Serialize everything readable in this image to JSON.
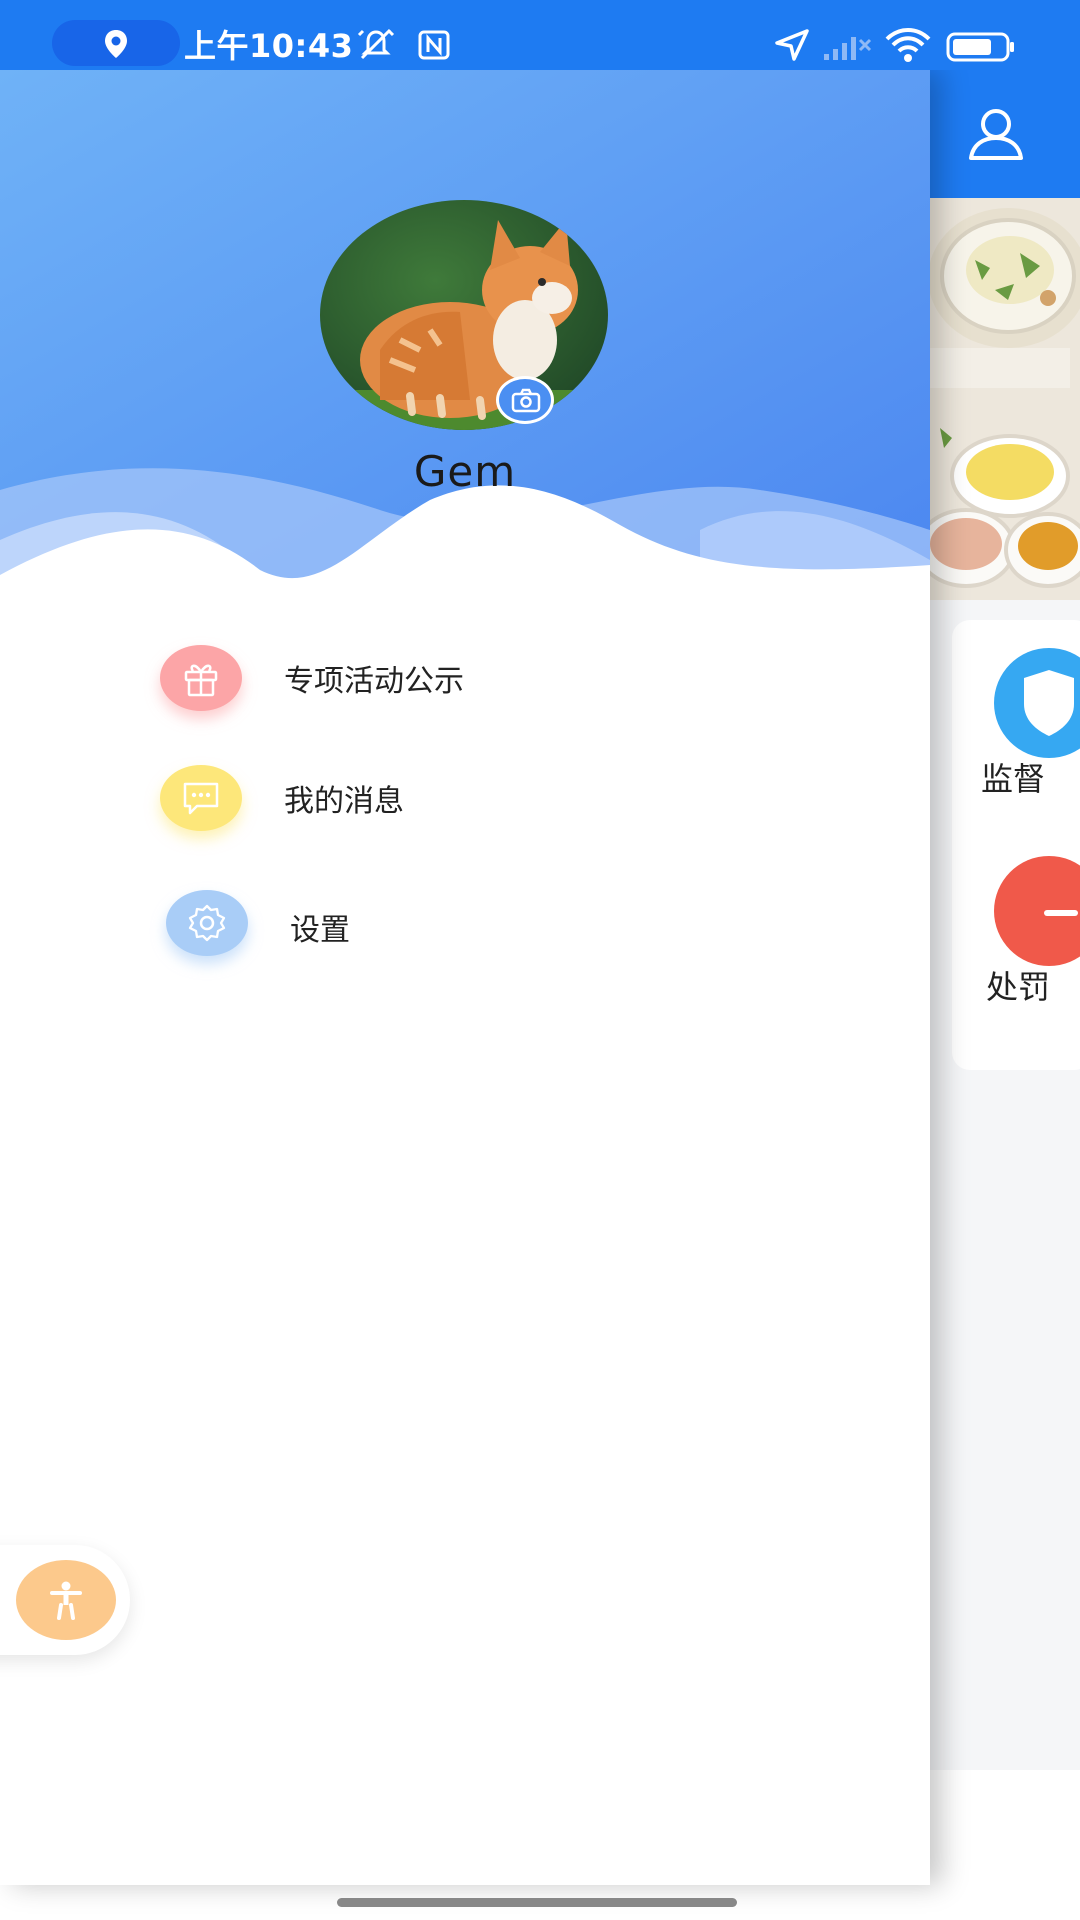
{
  "status_bar": {
    "time": "上午10:43",
    "icons": [
      "location-pin-icon",
      "alarm-off-icon",
      "nfc-icon",
      "navigation-icon",
      "signal-icon",
      "wifi-icon",
      "battery-icon"
    ]
  },
  "drawer": {
    "user": {
      "name": "Gem",
      "avatar_icon": "kitten-photo",
      "camera_icon": "camera-icon"
    },
    "menu": [
      {
        "label": "专项活动公示",
        "icon": "gift-icon",
        "color": "#fca5a7"
      },
      {
        "label": "我的消息",
        "icon": "message-icon",
        "color": "#fde77a"
      },
      {
        "label": "设置",
        "icon": "gear-icon",
        "color": "#a9cdf7"
      }
    ]
  },
  "background_app": {
    "header_icon": "user-icon",
    "cards": [
      {
        "label": "监督",
        "icon": "shield-icon",
        "color": "#36a8f2"
      },
      {
        "label": "处罚",
        "icon": "penalty-icon",
        "color": "#f0594a"
      }
    ]
  },
  "accessibility": {
    "icon": "accessibility-icon",
    "color": "#fcc98c"
  },
  "colors": {
    "primary": "#1e7bf2",
    "header_gradient_start": "#6fb2f7",
    "header_gradient_end": "#4b86f0"
  }
}
